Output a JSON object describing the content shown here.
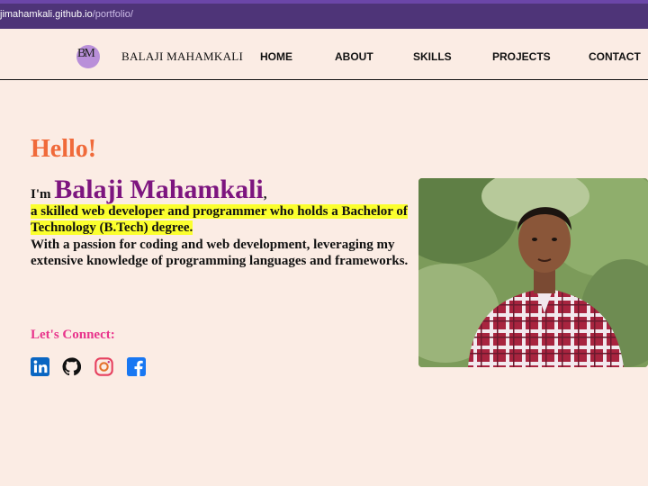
{
  "browser": {
    "url_host": "jimahamkali.github.io",
    "url_path": "/portfolio/"
  },
  "nav": {
    "logo_text": "BM",
    "brand": "BALAJI MAHAMKALI",
    "links": [
      "HOME",
      "ABOUT",
      "SKILLS",
      "PROJECTS",
      "CONTACT"
    ]
  },
  "hero": {
    "greeting": "Hello!",
    "im": "I'm",
    "name": "Balaji Mahamkali",
    "comma": ",",
    "highlight": "a skilled web developer and programmer who holds a Bachelor of Technology (B.Tech) degree.",
    "description": "With a passion for coding and web development, leveraging my extensive knowledge of programming languages and frameworks.",
    "connect": "Let's Connect:"
  },
  "socials": [
    "linkedin-icon",
    "github-icon",
    "instagram-icon",
    "facebook-icon"
  ],
  "colors": {
    "background": "#fbece4",
    "greeting": "#f06a3a",
    "name": "#7d157f",
    "highlight": "#fbff2e",
    "connect": "#e8348c"
  }
}
